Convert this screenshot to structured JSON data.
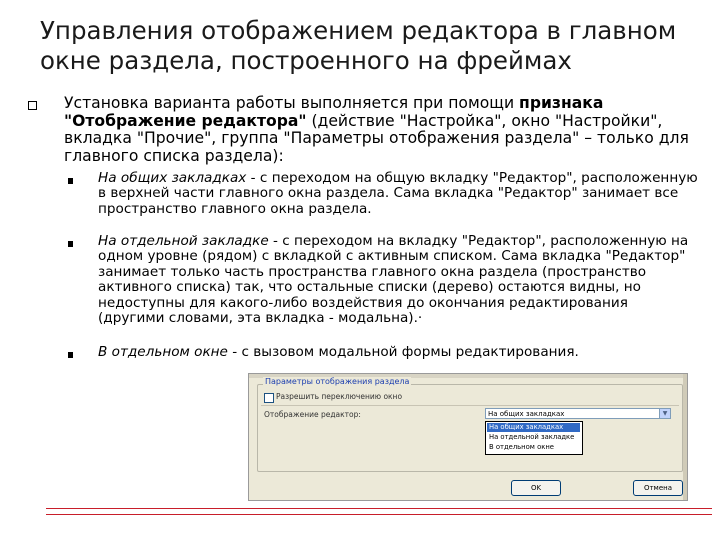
{
  "slide": {
    "title": "Управления отображением редактора в главном окне раздела, построенного на фреймах",
    "intro": {
      "before": "Установка варианта работы выполняется при помощи ",
      "bold": "признака \"Отображение редактора\"",
      "after": " (действие \"Настройка\", окно \"Настройки\", вкладка \"Прочие\", группа \"Параметры отображения раздела\" – только для главного списка раздела):"
    },
    "items": [
      {
        "italic": "На общих закладках",
        "rest": " - с переходом на общую вкладку \"Редактор\", расположенную в верхней части главного окна раздела. Сама вкладка \"Редактор\" занимает все пространство главного окна раздела."
      },
      {
        "italic": "На отдельной закладке",
        "rest": " - с переходом на вкладку \"Редактор\", расположенную на одном уровне (рядом) с вкладкой с активным списком. Сама вкладка \"Редактор\" занимает только часть пространства главного окна раздела (пространство активного списка) так, что остальные списки (дерево) остаются видны, но недоступны для какого-либо воздействия до окончания редактирования (другими словами, эта вкладка - модальна).·"
      },
      {
        "italic": "В отдельном окне",
        "rest": " - с вызовом модальной формы редактирования."
      }
    ]
  },
  "dialog": {
    "group_title": "Параметры отображения раздела",
    "checkbox_label": "Разрешить переключению окно",
    "select_label": "Отображение редактор:",
    "select_value": "На общих закладках",
    "options": [
      "На общих закладках",
      "На отдельной закладке",
      "В отдельном окне"
    ],
    "ok_label": "OK",
    "cancel_label": "Отмена"
  },
  "colors": {
    "selection": "#316ac5",
    "group_title": "#1e40b0",
    "accent_lines": "#c81e2a"
  }
}
